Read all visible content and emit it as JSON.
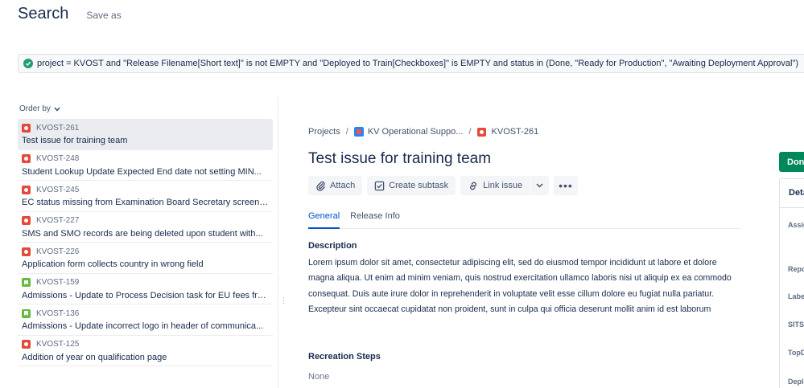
{
  "header": {
    "title": "Search",
    "save_as": "Save as"
  },
  "jql": {
    "query": "project = KVOST and \"Release Filename[Short text]\" is not EMPTY and \"Deployed to Train[Checkboxes]\" is EMPTY and status in (Done, \"Ready for Production\", \"Awaiting Deployment Approval\")"
  },
  "order_by": {
    "label": "Order by"
  },
  "issues": [
    {
      "key": "KVOST-261",
      "summary": "Test issue for training team",
      "type": "bug"
    },
    {
      "key": "KVOST-248",
      "summary": "Student Lookup Update Expected End date not setting MIN...",
      "type": "bug"
    },
    {
      "key": "KVOST-245",
      "summary": "EC status missing from Examination Board Secretary screen-...",
      "type": "bug"
    },
    {
      "key": "KVOST-227",
      "summary": "SMS and SMO records are being deleted upon student with...",
      "type": "bug"
    },
    {
      "key": "KVOST-226",
      "summary": "Application form collects country in wrong field",
      "type": "bug"
    },
    {
      "key": "KVOST-159",
      "summary": "Admissions - Update to Process Decision task for EU fees fro...",
      "type": "story"
    },
    {
      "key": "KVOST-136",
      "summary": "Admissions - Update incorrect logo in header of communica...",
      "type": "story"
    },
    {
      "key": "KVOST-125",
      "summary": "Addition of year on qualification page",
      "type": "bug"
    }
  ],
  "breadcrumb": {
    "projects": "Projects",
    "project": "KV Operational Suppo...",
    "issue": "KVOST-261",
    "sep": "/"
  },
  "issue": {
    "title": "Test issue for training team",
    "actions": {
      "attach": "Attach",
      "create_subtask": "Create subtask",
      "link_issue": "Link issue",
      "more": "•••"
    },
    "tabs": {
      "general": "General",
      "release_info": "Release Info"
    },
    "description_label": "Description",
    "description": "Lorem ipsum dolor sit amet, consectetur adipiscing elit, sed do eiusmod tempor incididunt ut labore et dolore magna aliqua. Ut enim ad minim veniam, quis nostrud exercitation ullamco laboris nisi ut aliquip ex ea commodo consequat. Duis aute irure dolor in reprehenderit in voluptate velit esse cillum dolore eu fugiat nulla pariatur. Excepteur sint occaecat cupidatat non proident, sunt in culpa qui officia deserunt mollit anim id est laborum",
    "recreation_label": "Recreation Steps",
    "recreation_value": "None"
  },
  "status_button": "Done",
  "details": {
    "heading": "Details",
    "fields": [
      "Assignee",
      "Reporter",
      "Labels",
      "SITS",
      "TopDesk",
      "Deployed"
    ]
  },
  "colors": {
    "accent": "#0052cc",
    "done": "#00875a",
    "bug": "#e5493a",
    "story": "#63ba3c",
    "valid": "#22a06b"
  }
}
